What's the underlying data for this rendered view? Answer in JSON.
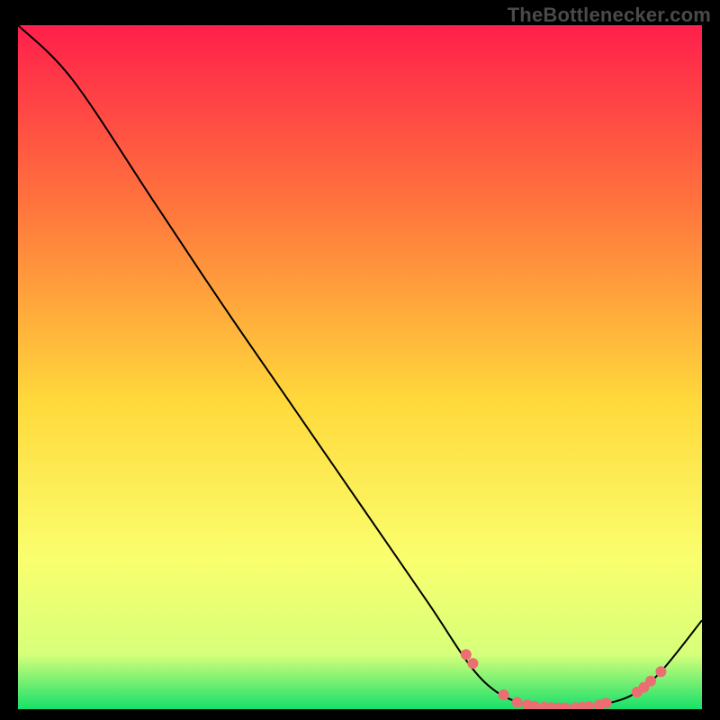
{
  "watermark": "TheBottlenecker.com",
  "chart_data": {
    "type": "line",
    "title": "",
    "xlabel": "",
    "ylabel": "",
    "xlim": [
      0,
      100
    ],
    "ylim": [
      0,
      100
    ],
    "grid": false,
    "series": [
      {
        "name": "curve",
        "x": [
          0,
          8,
          20,
          30,
          40,
          50,
          60,
          66,
          70,
          74,
          78,
          82,
          86,
          90,
          94,
          100
        ],
        "y": [
          100,
          92,
          74,
          59,
          44.5,
          30,
          15.5,
          6.5,
          2.5,
          0.8,
          0.2,
          0.2,
          0.8,
          2.2,
          5.5,
          13
        ]
      }
    ],
    "markers": {
      "name": "points",
      "x": [
        65.5,
        66.5,
        71,
        73,
        74.5,
        75.5,
        77,
        78,
        79,
        80,
        81.5,
        82.5,
        83.5,
        85,
        86,
        90.5,
        91.5,
        92.5,
        94
      ],
      "y": [
        8.0,
        6.7,
        2.1,
        1.0,
        0.6,
        0.45,
        0.3,
        0.22,
        0.2,
        0.2,
        0.22,
        0.28,
        0.4,
        0.65,
        0.9,
        2.5,
        3.2,
        4.1,
        5.5
      ]
    },
    "colors": {
      "gradient_top": "#ff1f4b",
      "gradient_mid_upper": "#ff7a3c",
      "gradient_mid": "#ffd93b",
      "gradient_mid_lower": "#faff6e",
      "gradient_low": "#d6ff7a",
      "gradient_bottom": "#16e06b",
      "line": "#000000",
      "marker": "#eb6e72"
    }
  }
}
